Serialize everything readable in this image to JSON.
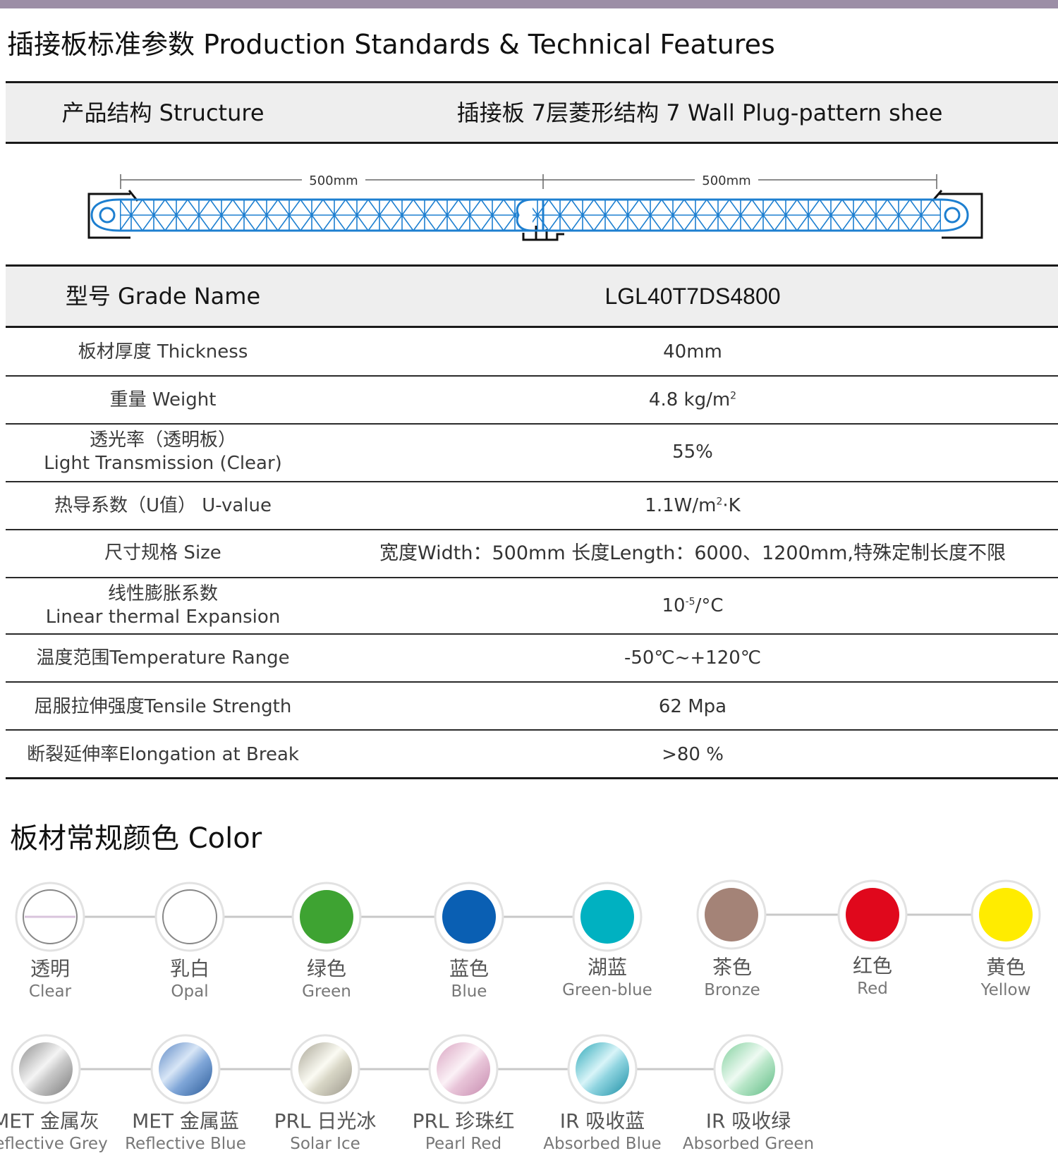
{
  "page_title": "插接板标准参数 Production Standards & Technical Features",
  "structure": {
    "label": "产品结构 Structure",
    "value": "插接板 7层菱形结构 7 Wall Plug-pattern shee",
    "dim_left": "500mm",
    "dim_right": "500mm"
  },
  "grade": {
    "label": "型号  Grade Name",
    "value": "LGL40T7DS4800"
  },
  "specs": {
    "thickness": {
      "label": "板材厚度  Thickness",
      "value": "40mm"
    },
    "weight": {
      "label": "重量  Weight",
      "value": "4.8 kg/m",
      "sup": "2"
    },
    "light": {
      "label_cn": "透光率（透明板）",
      "label_en": "Light Transmission (Clear)",
      "value": "55%"
    },
    "uvalue": {
      "label": "热导系数（U值）  U-value",
      "value_a": "1.1W/m",
      "sup": "2",
      "value_b": "·K"
    },
    "size": {
      "label": "尺寸规格  Size",
      "value": "宽度Width：500mm   长度Length：6000、1200mm,特殊定制长度不限"
    },
    "expansion": {
      "label_cn": "线性膨胀系数",
      "label_en": "Linear thermal Expansion",
      "value_a": "10",
      "sup": "-5",
      "value_b": "/°C"
    },
    "temperature": {
      "label": "温度范围Temperature Range",
      "value": "-50℃~+120℃"
    },
    "tensile": {
      "label": "屈服拉伸强度Tensile Strength",
      "value": "62 Mpa"
    },
    "elongation": {
      "label": "断裂延伸率Elongation at Break",
      "value": ">80 %"
    }
  },
  "color_title": "板材常规颜色 Color",
  "colors_row1": [
    {
      "cn": "透明",
      "en": "Clear",
      "hex": "#ffffff"
    },
    {
      "cn": "乳白",
      "en": "Opal",
      "hex": "#ffffff"
    },
    {
      "cn": "绿色",
      "en": "Green",
      "hex": "#3ea332"
    },
    {
      "cn": "蓝色",
      "en": "Blue",
      "hex": "#0a5fb3"
    },
    {
      "cn": "湖蓝",
      "en": "Green-blue",
      "hex": "#00b1c1"
    },
    {
      "cn": "茶色",
      "en": "Bronze",
      "hex": "#a48377"
    },
    {
      "cn": "红色",
      "en": "Red",
      "hex": "#e0081c"
    },
    {
      "cn": "黄色",
      "en": "Yellow",
      "hex": "#ffec00"
    }
  ],
  "colors_row2": [
    {
      "cn": "MET 金属灰",
      "en": "Reflective Grey"
    },
    {
      "cn": "MET 金属蓝",
      "en": "Reflective Blue"
    },
    {
      "cn": "PRL 日光冰",
      "en": "Solar Ice"
    },
    {
      "cn": "PRL 珍珠红",
      "en": "Pearl Red"
    },
    {
      "cn": "IR 吸收蓝",
      "en": "Absorbed Blue"
    },
    {
      "cn": "IR 吸收绿",
      "en": "Absorbed Green"
    }
  ]
}
